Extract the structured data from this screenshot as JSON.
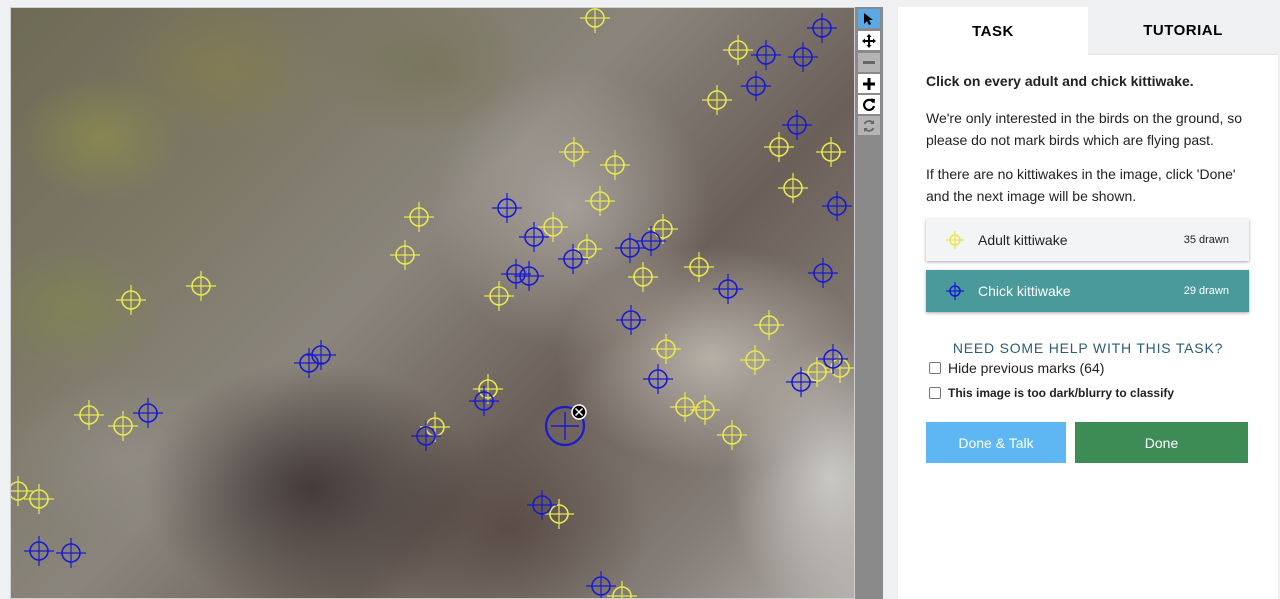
{
  "tabs": {
    "task": "TASK",
    "tutorial": "TUTORIAL"
  },
  "instructions": {
    "title": "Click on every adult and chick kittiwake.",
    "p1": "We're only interested in the birds on the ground, so please do not mark birds which are flying past.",
    "p2": "If there are no kittiwakes in the image, click 'Done' and the next image will be shown."
  },
  "tools": [
    {
      "label": "Adult kittiwake",
      "count": "35 drawn",
      "color": "#e8e850",
      "icon": "crosshair-icon"
    },
    {
      "label": "Chick kittiwake",
      "count": "29 drawn",
      "color": "#1a1ad0",
      "icon": "crosshair-icon"
    }
  ],
  "help": "NEED SOME HELP WITH THIS TASK?",
  "options": {
    "hide_marks": "Hide previous marks (64)",
    "too_dark": "This image is too dark/blurry to classify"
  },
  "buttons": {
    "done_talk": "Done & Talk",
    "done": "Done"
  },
  "toolbar": [
    "pointer-icon",
    "move-icon",
    "zoom-out-icon",
    "zoom-in-icon",
    "rotate-icon",
    "reset-icon"
  ],
  "colors": {
    "adult": "#e8e850",
    "chick": "#1a1ad0",
    "chick_button": "#4a9a9c",
    "done": "#3d8b55",
    "done_talk": "#5eb7f2",
    "toolbar_active": "#5aa9e6"
  }
}
